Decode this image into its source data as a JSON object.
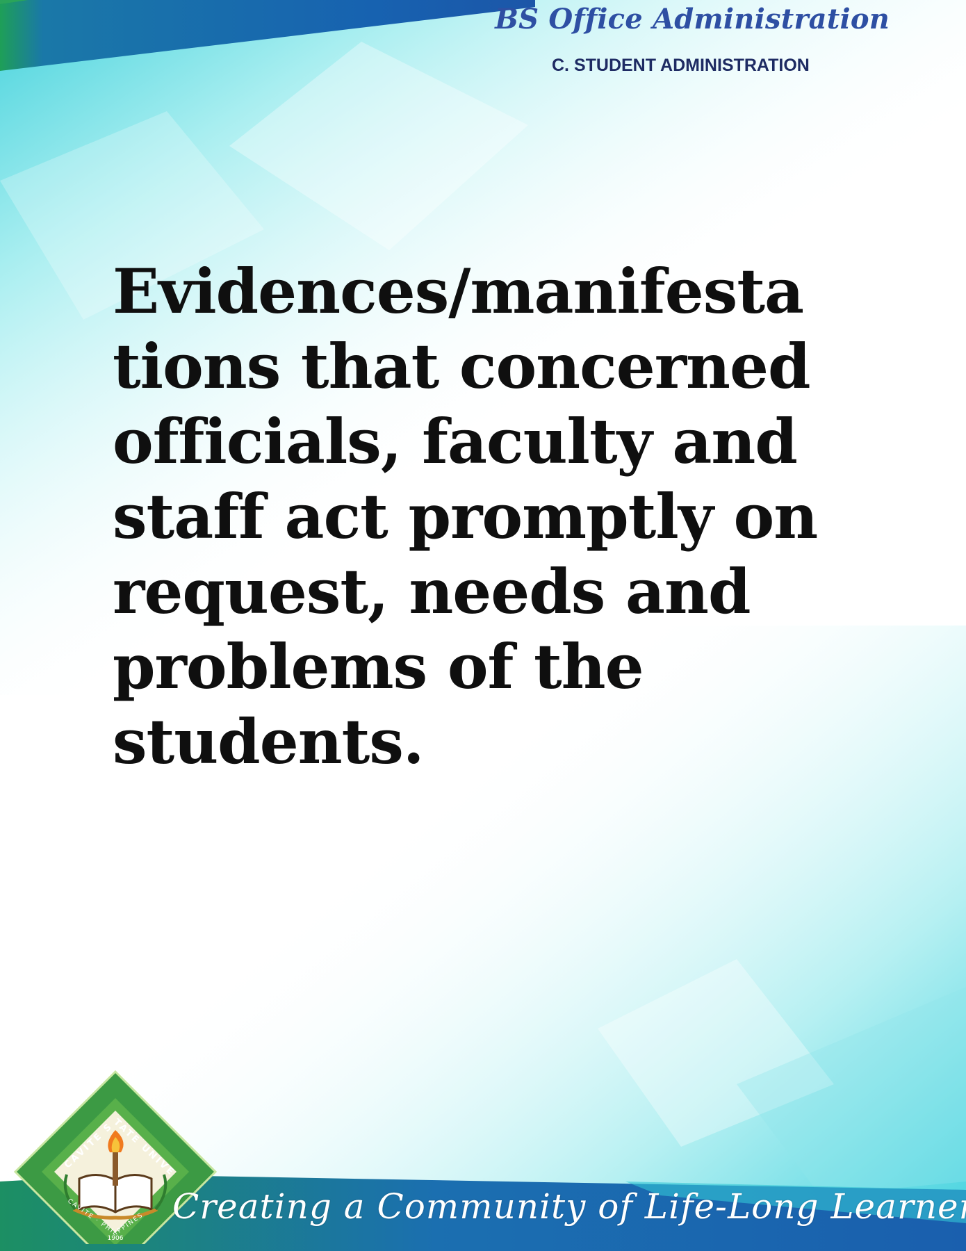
{
  "header": {
    "program": "BS Office Administration",
    "section": "C. STUDENT ADMINISTRATION"
  },
  "main": {
    "statement_lines": [
      "Evidences/manifesta",
      "tions that concerned",
      "officials, faculty and",
      "staff act promptly on",
      "request, needs and",
      "problems of the",
      "students."
    ]
  },
  "footer": {
    "tagline": "Creating a Community of Life-Long Learners",
    "seal_text_top": "CAVITE STATE UNIVERSITY",
    "seal_text_bottom": "CAVITE · PHILIPPINES",
    "seal_year": "1906"
  },
  "colors": {
    "banner_blue": "#1b64b0",
    "banner_green": "#1fa04c",
    "cyan_wash": "#7fe3e8",
    "program_text": "#2e4fa3",
    "section_text": "#1e2b63",
    "statement_text": "#0f0f0f"
  }
}
